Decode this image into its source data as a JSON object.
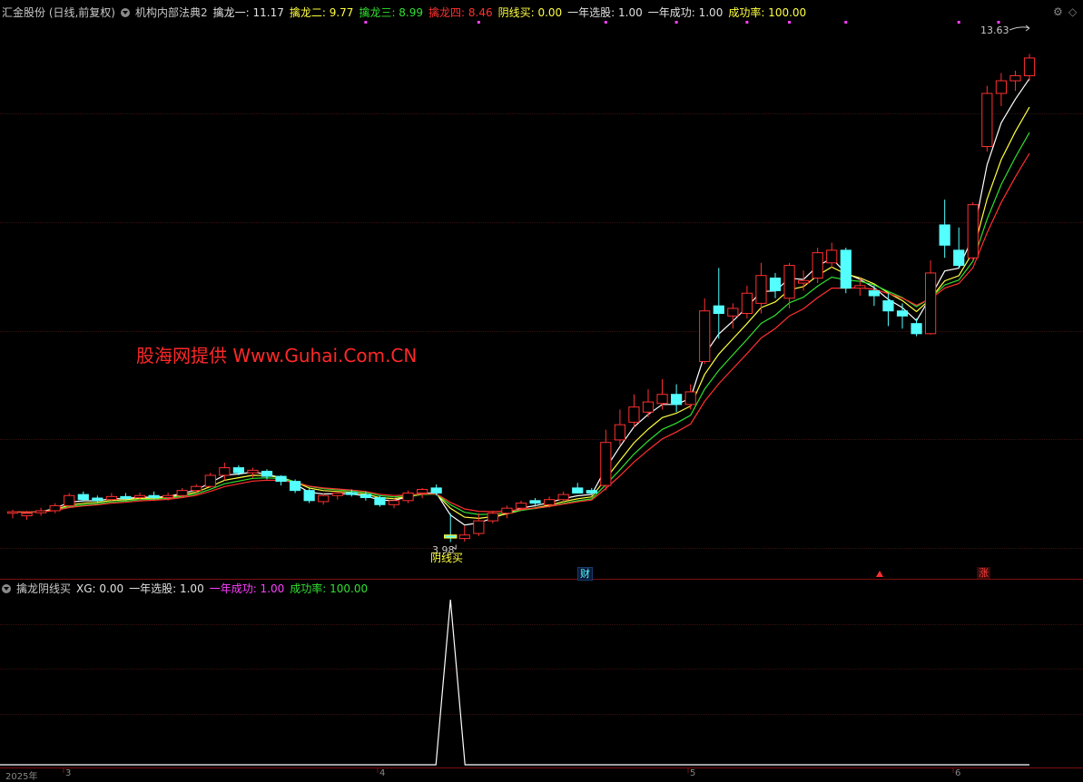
{
  "header": {
    "stock": "汇金股份 (日线,前复权)",
    "indicator": "机构内部法典2",
    "items": [
      {
        "label": "擒龙一: 11.17",
        "color": "#e0e0e0"
      },
      {
        "label": "擒龙二: 9.77",
        "color": "#ffff40"
      },
      {
        "label": "擒龙三: 8.99",
        "color": "#30e030"
      },
      {
        "label": "擒龙四: 8.46",
        "color": "#ff3030"
      },
      {
        "label": "阴线买: 0.00",
        "color": "#ffff40"
      },
      {
        "label": "一年选股: 1.00",
        "color": "#e0e0e0"
      },
      {
        "label": "一年成功: 1.00",
        "color": "#e0e0e0"
      },
      {
        "label": "成功率: 100.00",
        "color": "#ffff40"
      }
    ]
  },
  "sub_header": {
    "indicator": "擒龙阴线买",
    "items": [
      {
        "label": "XG: 0.00",
        "color": "#e0e0e0"
      },
      {
        "label": "一年选股: 1.00",
        "color": "#e0e0e0"
      },
      {
        "label": "一年成功: 1.00",
        "color": "#ff40ff"
      },
      {
        "label": "成功率: 100.00",
        "color": "#30e030"
      }
    ]
  },
  "watermark": "股海网提供 Www.Guhai.Com.CN",
  "annotations": {
    "high_price": "13.63",
    "low_price": "3.98",
    "signal": "阴线买",
    "fin_mark": "财",
    "rise_mark": "涨"
  },
  "axis_labels": [
    "2025年",
    "3",
    "4",
    "5",
    "6"
  ],
  "colors": {
    "up": "#ff3030",
    "down": "#54ffff",
    "ma1": "#ffffff",
    "ma2": "#ffff40",
    "ma3": "#30e030",
    "ma4": "#ff3030"
  },
  "chart_data": {
    "type": "candlestick",
    "ohlc": [
      [
        4.55,
        4.62,
        4.45,
        4.58
      ],
      [
        4.5,
        4.6,
        4.42,
        4.55
      ],
      [
        4.56,
        4.66,
        4.5,
        4.6
      ],
      [
        4.6,
        4.75,
        4.55,
        4.7
      ],
      [
        4.7,
        4.95,
        4.65,
        4.9
      ],
      [
        4.92,
        4.98,
        4.78,
        4.82
      ],
      [
        4.85,
        4.9,
        4.75,
        4.8
      ],
      [
        4.82,
        4.95,
        4.78,
        4.88
      ],
      [
        4.88,
        4.95,
        4.8,
        4.84
      ],
      [
        4.86,
        4.96,
        4.8,
        4.9
      ],
      [
        4.9,
        4.98,
        4.82,
        4.86
      ],
      [
        4.86,
        4.96,
        4.8,
        4.9
      ],
      [
        4.9,
        5.05,
        4.85,
        5.0
      ],
      [
        5.0,
        5.12,
        4.95,
        5.08
      ],
      [
        5.08,
        5.35,
        5.05,
        5.3
      ],
      [
        5.3,
        5.55,
        5.2,
        5.45
      ],
      [
        5.45,
        5.5,
        5.3,
        5.35
      ],
      [
        5.35,
        5.45,
        5.25,
        5.4
      ],
      [
        5.38,
        5.42,
        5.22,
        5.28
      ],
      [
        5.28,
        5.3,
        5.1,
        5.18
      ],
      [
        5.18,
        5.22,
        4.95,
        5.0
      ],
      [
        5.0,
        5.05,
        4.75,
        4.8
      ],
      [
        4.78,
        4.95,
        4.72,
        4.9
      ],
      [
        4.9,
        4.98,
        4.82,
        4.95
      ],
      [
        4.96,
        5.02,
        4.88,
        4.92
      ],
      [
        4.92,
        4.98,
        4.8,
        4.86
      ],
      [
        4.86,
        4.9,
        4.68,
        4.72
      ],
      [
        4.72,
        4.85,
        4.65,
        4.8
      ],
      [
        4.8,
        5.0,
        4.75,
        4.95
      ],
      [
        4.95,
        5.05,
        4.85,
        5.02
      ],
      [
        5.05,
        5.12,
        4.9,
        4.95
      ],
      [
        4.1,
        4.55,
        3.98,
        4.08
      ],
      [
        4.05,
        4.3,
        3.99,
        4.12
      ],
      [
        4.15,
        4.55,
        4.1,
        4.4
      ],
      [
        4.4,
        4.6,
        4.35,
        4.55
      ],
      [
        4.55,
        4.7,
        4.45,
        4.65
      ],
      [
        4.65,
        4.8,
        4.6,
        4.75
      ],
      [
        4.8,
        4.85,
        4.68,
        4.75
      ],
      [
        4.72,
        4.88,
        4.66,
        4.82
      ],
      [
        4.82,
        4.98,
        4.78,
        4.92
      ],
      [
        5.05,
        5.15,
        4.98,
        4.95
      ],
      [
        5.0,
        5.05,
        4.9,
        4.95
      ],
      [
        5.1,
        6.2,
        5.0,
        5.95
      ],
      [
        6.0,
        6.6,
        5.9,
        6.3
      ],
      [
        6.35,
        6.9,
        6.25,
        6.65
      ],
      [
        6.55,
        7.0,
        6.45,
        6.75
      ],
      [
        6.72,
        7.2,
        6.6,
        6.9
      ],
      [
        6.9,
        7.1,
        6.55,
        6.7
      ],
      [
        6.7,
        7.1,
        6.6,
        6.95
      ],
      [
        7.55,
        8.8,
        7.5,
        8.55
      ],
      [
        8.65,
        9.4,
        8.0,
        8.5
      ],
      [
        8.45,
        8.7,
        8.2,
        8.6
      ],
      [
        8.5,
        9.05,
        8.4,
        8.9
      ],
      [
        8.7,
        9.5,
        8.5,
        9.25
      ],
      [
        9.2,
        9.3,
        8.8,
        8.95
      ],
      [
        8.8,
        9.5,
        8.6,
        9.45
      ],
      [
        9.1,
        9.35,
        8.95,
        9.15
      ],
      [
        9.2,
        9.8,
        9.1,
        9.7
      ],
      [
        9.5,
        9.9,
        9.4,
        9.75
      ],
      [
        9.75,
        9.8,
        8.9,
        9.0
      ],
      [
        9.0,
        9.2,
        8.85,
        9.05
      ],
      [
        8.95,
        9.05,
        8.65,
        8.85
      ],
      [
        8.75,
        8.9,
        8.25,
        8.55
      ],
      [
        8.55,
        8.7,
        8.2,
        8.45
      ],
      [
        8.3,
        8.4,
        8.05,
        8.1
      ],
      [
        8.1,
        9.55,
        8.08,
        9.3
      ],
      [
        10.25,
        10.75,
        9.6,
        9.85
      ],
      [
        9.75,
        10.2,
        9.4,
        9.45
      ],
      [
        9.6,
        10.7,
        9.55,
        10.65
      ],
      [
        11.8,
        13.0,
        11.7,
        12.85
      ],
      [
        12.85,
        13.25,
        12.6,
        13.1
      ],
      [
        13.1,
        13.3,
        12.9,
        13.2
      ],
      [
        13.2,
        13.63,
        13.1,
        13.55
      ]
    ],
    "ma_values": {
      "擒龙一": 11.17,
      "擒龙二": 9.77,
      "擒龙三": 8.99,
      "擒龙四": 8.46
    },
    "xg_series": {
      "signal_index": 31,
      "value": 1
    }
  }
}
